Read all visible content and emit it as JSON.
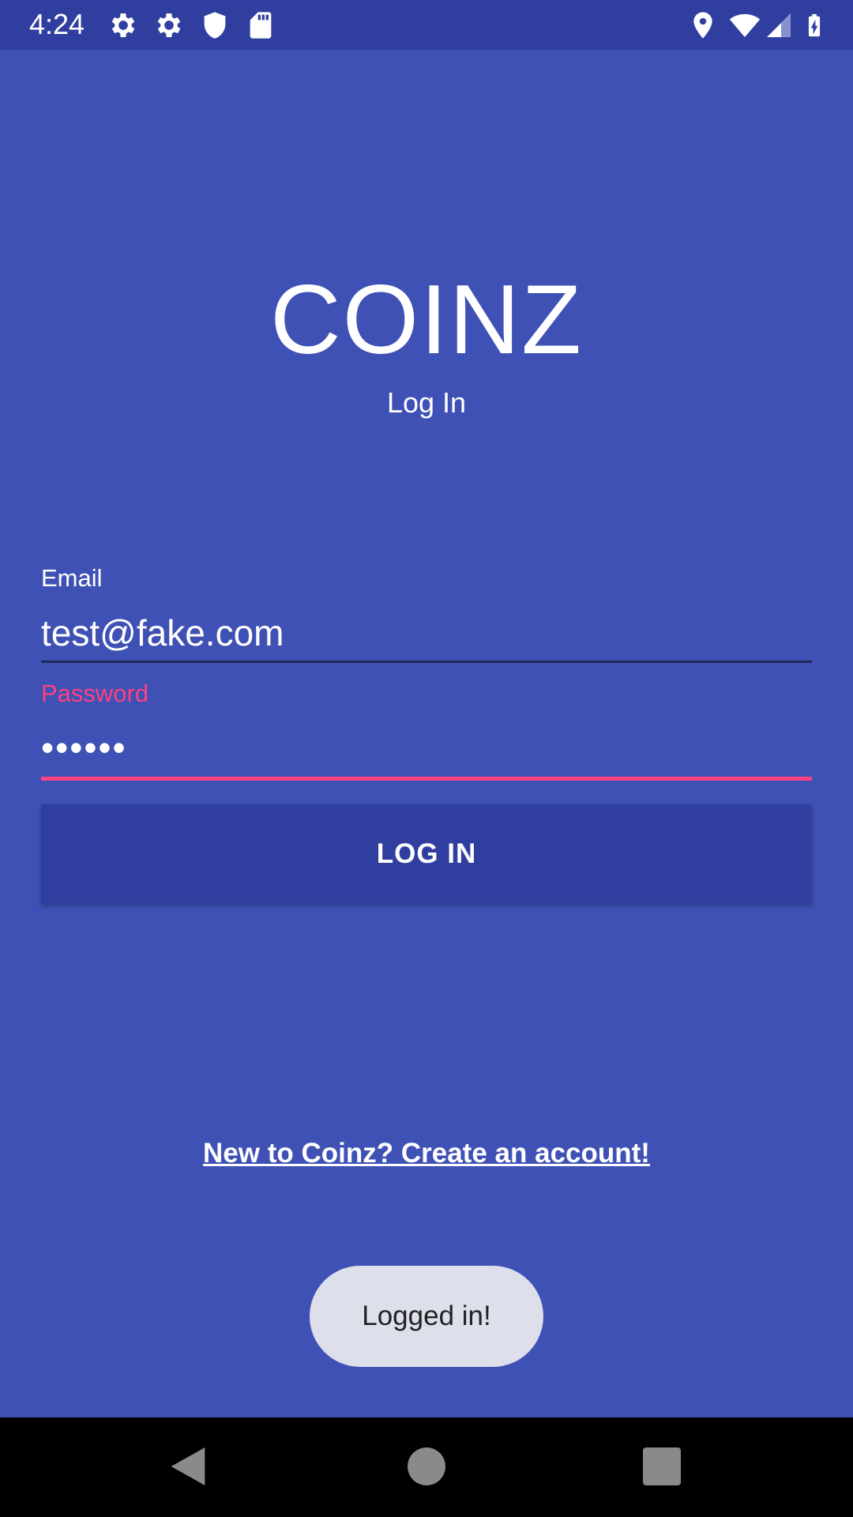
{
  "status_bar": {
    "time": "4:24",
    "left_icons": [
      "settings-icon",
      "settings-icon",
      "shield-icon",
      "sd-card-icon"
    ],
    "right_icons": [
      "location-icon",
      "wifi-icon",
      "signal-icon",
      "battery-charging-icon"
    ]
  },
  "login": {
    "app_title": "COINZ",
    "subtitle": "Log In",
    "email_label": "Email",
    "email_value": "test@fake.com",
    "password_label": "Password",
    "password_value": "••••••",
    "login_button": "LOG IN",
    "create_account_link": "New to Coinz? Create an account!"
  },
  "toast": {
    "message": "Logged in!"
  },
  "nav_bar": {
    "buttons": [
      "back-icon",
      "home-icon",
      "recents-icon"
    ]
  },
  "colors": {
    "background": "#3F51B5",
    "primary_dark": "#303F9F",
    "accent": "#FF4081",
    "toast_bg": "#DDDFEB"
  }
}
